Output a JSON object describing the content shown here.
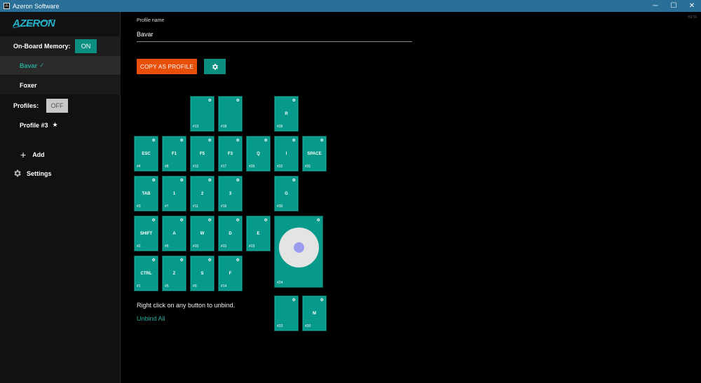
{
  "window": {
    "title": "Azeron Software",
    "minimize": "─",
    "maximize": "☐",
    "close": "✕"
  },
  "beta_label": "BETA",
  "sidebar": {
    "logo_text": "AZERON",
    "memory_label": "On-Board Memory:",
    "memory_toggle": "ON",
    "memory_profiles": [
      {
        "label": "Bavar",
        "active": true,
        "check": "✓"
      },
      {
        "label": "Foxer",
        "active": false
      }
    ],
    "profiles_label": "Profiles:",
    "profiles_toggle": "OFF",
    "local_profiles": [
      {
        "label": "Profile #3",
        "star": "★"
      }
    ],
    "add_label": "Add",
    "settings_label": "Settings"
  },
  "main": {
    "profile_name_label": "Profile name",
    "profile_name_value": "Bavar",
    "copy_button": "COPY AS PROFILE",
    "hint": "Right click on any button to unbind.",
    "unbind_all": "Unbind All"
  },
  "keys": [
    {
      "label": "",
      "num": "#13"
    },
    {
      "label": "",
      "num": "#18"
    },
    {
      "label": "R",
      "num": "#28"
    },
    {
      "label": "ESC",
      "num": "#4"
    },
    {
      "label": "F1",
      "num": "#8"
    },
    {
      "label": "F5",
      "num": "#12"
    },
    {
      "label": "F3",
      "num": "#17"
    },
    {
      "label": "Q",
      "num": "#29"
    },
    {
      "label": "I",
      "num": "#22"
    },
    {
      "label": "SPACE",
      "num": "#31"
    },
    {
      "label": "TAB",
      "num": "#3"
    },
    {
      "label": "1",
      "num": "#7"
    },
    {
      "label": "2",
      "num": "#11"
    },
    {
      "label": "3",
      "num": "#16"
    },
    {
      "label": "G",
      "num": "#30"
    },
    {
      "label": "SHIFT",
      "num": "#2"
    },
    {
      "label": "A",
      "num": "#6"
    },
    {
      "label": "W",
      "num": "#10"
    },
    {
      "label": "D",
      "num": "#15"
    },
    {
      "label": "E",
      "num": "#19"
    },
    {
      "label": "CTRL",
      "num": "#1"
    },
    {
      "label": "Z",
      "num": "#5"
    },
    {
      "label": "S",
      "num": "#9"
    },
    {
      "label": "F",
      "num": "#14"
    },
    {
      "label": "",
      "num": "#23"
    },
    {
      "label": "M",
      "num": "#20"
    }
  ],
  "joystick": {
    "num": "#24"
  }
}
